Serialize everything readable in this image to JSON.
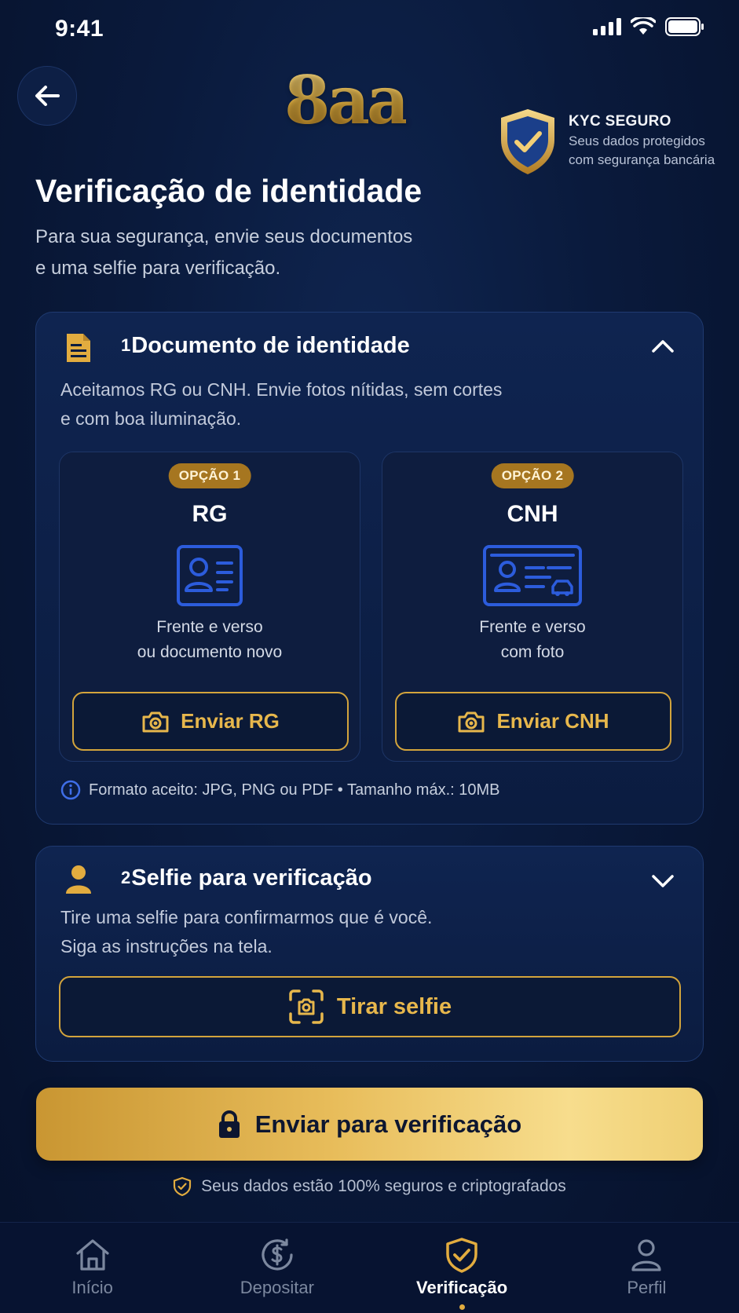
{
  "status_bar": {
    "time": "9:41"
  },
  "header": {
    "logo_text": "8aa",
    "kyc": {
      "title": "KYC SEGURO",
      "line1": "Seus dados protegidos",
      "line2": "com segurança bancária"
    }
  },
  "page": {
    "title": "Verificação de identidade",
    "subtitle_line1": "Para sua segurança, envie seus documentos",
    "subtitle_line2": "e uma selfie para verificação."
  },
  "document_section": {
    "number": "1",
    "title": "Documento de identidade",
    "desc_line1": "Aceitamos RG ou CNH. Envie fotos nítidas, sem cortes",
    "desc_line2": "e com boa iluminação.",
    "options": [
      {
        "badge": "OPÇÃO 1",
        "name": "RG",
        "desc_line1": "Frente e verso",
        "desc_line2": "ou documento novo",
        "button": "Enviar RG"
      },
      {
        "badge": "OPÇÃO 2",
        "name": "CNH",
        "desc_line1": "Frente e verso",
        "desc_line2": "com foto",
        "button": "Enviar CNH"
      }
    ],
    "format_note": "Formato aceito: JPG, PNG ou PDF • Tamanho máx.: 10MB"
  },
  "selfie_section": {
    "number": "2",
    "title": "Selfie para verificação",
    "desc_line1": "Tire uma selfie para confirmarmos que é você.",
    "desc_line2": "Siga as instruções na tela.",
    "button": "Tirar selfie"
  },
  "submit": {
    "label": "Enviar para verificação",
    "secure_note": "Seus dados estão 100% seguros e criptografados"
  },
  "nav": {
    "items": [
      {
        "label": "Início",
        "icon": "home-icon"
      },
      {
        "label": "Depositar",
        "icon": "dollar-circle-icon"
      },
      {
        "label": "Verificação",
        "icon": "shield-check-icon",
        "active": true
      },
      {
        "label": "Perfil",
        "icon": "user-icon"
      }
    ]
  },
  "colors": {
    "background": "#0a1a3c",
    "gold": "#e2ac3f",
    "icon_blue": "#2c5cdc"
  }
}
